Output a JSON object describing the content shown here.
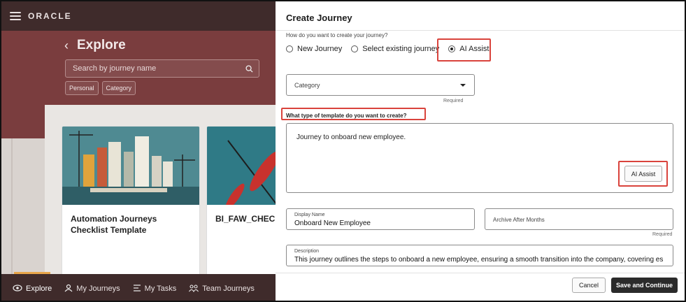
{
  "app": {
    "brand": "ORACLE",
    "page_title": "Explore",
    "search_placeholder": "Search by journey name",
    "chips": [
      "Personal",
      "Category"
    ],
    "cards": [
      {
        "title": "Automation Journeys Checklist Template"
      },
      {
        "title": "BI_FAW_CHECK"
      }
    ],
    "nav": [
      {
        "label": "Explore",
        "icon": "eye-icon"
      },
      {
        "label": "My Journeys",
        "icon": "person-icon"
      },
      {
        "label": "My Tasks",
        "icon": "tasks-icon"
      },
      {
        "label": "Team Journeys",
        "icon": "team-icon"
      }
    ],
    "colors": {
      "header": "#3f2b2b",
      "body": "#7a3d3e",
      "accent": "#e6a54a"
    }
  },
  "drawer": {
    "title": "Create Journey",
    "question": "How do you want to create your journey?",
    "options": [
      {
        "label": "New Journey",
        "selected": false
      },
      {
        "label": "Select existing journey",
        "selected": false
      },
      {
        "label": "AI Assist",
        "selected": true
      }
    ],
    "category": {
      "label": "Category",
      "required": "Required"
    },
    "template_question": "What type of template do you want to create?",
    "template_text": "Journey to onboard new employee.",
    "ai_button": "AI Assist",
    "display_name": {
      "label": "Display Name",
      "value": "Onboard New Employee"
    },
    "archive": {
      "label": "Archive After Months",
      "required": "Required"
    },
    "description": {
      "label": "Description",
      "value": "This journey outlines the steps to onboard a new employee, ensuring a smooth transition into the company, covering es"
    },
    "buttons": {
      "cancel": "Cancel",
      "save": "Save and Continue"
    },
    "colors": {
      "highlight": "#d9433c",
      "primary_button": "#2b2b2b"
    }
  }
}
